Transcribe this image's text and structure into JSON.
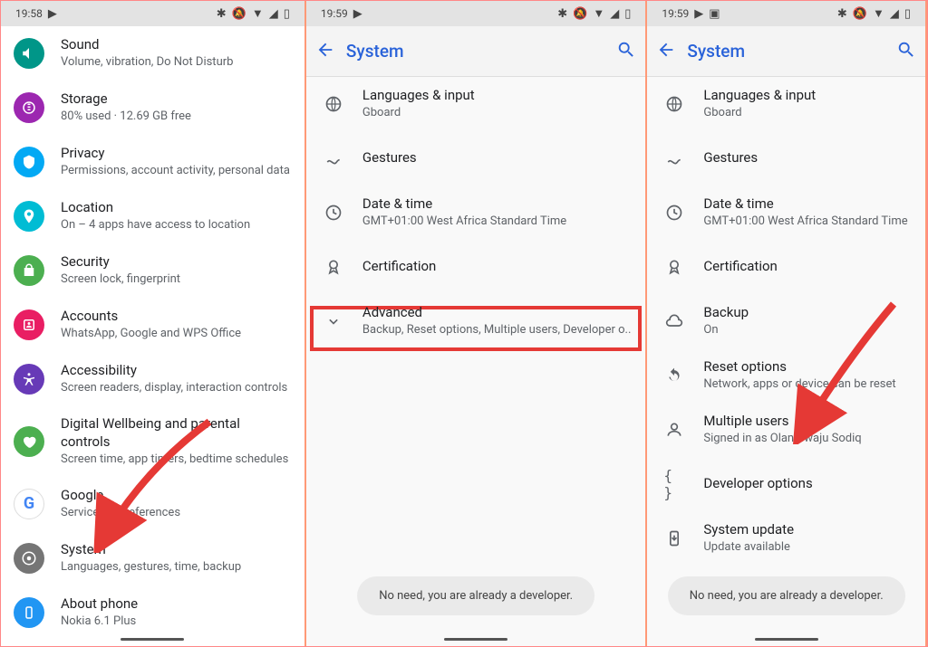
{
  "panel1": {
    "time": "19:58",
    "items": [
      {
        "title": "Sound",
        "sub": "Volume, vibration, Do Not Disturb"
      },
      {
        "title": "Storage",
        "sub": "80% used · 12.69 GB free"
      },
      {
        "title": "Privacy",
        "sub": "Permissions, account activity, personal data"
      },
      {
        "title": "Location",
        "sub": "On – 4 apps have access to location"
      },
      {
        "title": "Security",
        "sub": "Screen lock, fingerprint"
      },
      {
        "title": "Accounts",
        "sub": "WhatsApp, Google and WPS Office"
      },
      {
        "title": "Accessibility",
        "sub": "Screen readers, display, interaction controls"
      },
      {
        "title": "Digital Wellbeing and parental controls",
        "sub": "Screen time, app timers, bedtime schedules"
      },
      {
        "title": "Google",
        "sub": "Services & preferences"
      },
      {
        "title": "System",
        "sub": "Languages, gestures, time, backup"
      },
      {
        "title": "About phone",
        "sub": "Nokia 6.1 Plus"
      }
    ],
    "iconColors": [
      "#009688",
      "#9c27b0",
      "#03a9f4",
      "#00bcd4",
      "#4caf50",
      "#e91e63",
      "#673ab7",
      "#4caf50",
      "#ffffff",
      "#757575",
      "#2196f3"
    ]
  },
  "panel2": {
    "time": "19:59",
    "header": "System",
    "items": [
      {
        "title": "Languages & input",
        "sub": "Gboard"
      },
      {
        "title": "Gestures",
        "sub": ""
      },
      {
        "title": "Date & time",
        "sub": "GMT+01:00 West Africa Standard Time"
      },
      {
        "title": "Certification",
        "sub": ""
      },
      {
        "title": "Advanced",
        "sub": "Backup, Reset options, Multiple users, Developer o.."
      }
    ],
    "toast": "No need, you are already a developer."
  },
  "panel3": {
    "time": "19:59",
    "header": "System",
    "items": [
      {
        "title": "Languages & input",
        "sub": "Gboard"
      },
      {
        "title": "Gestures",
        "sub": ""
      },
      {
        "title": "Date & time",
        "sub": "GMT+01:00 West Africa Standard Time"
      },
      {
        "title": "Certification",
        "sub": ""
      },
      {
        "title": "Backup",
        "sub": "On"
      },
      {
        "title": "Reset options",
        "sub": "Network, apps or device can be reset"
      },
      {
        "title": "Multiple users",
        "sub": "Signed in as Olanrewaju Sodiq"
      },
      {
        "title": "Developer options",
        "sub": ""
      },
      {
        "title": "System update",
        "sub": "Update available"
      }
    ],
    "toast": "No need, you are already a developer."
  }
}
